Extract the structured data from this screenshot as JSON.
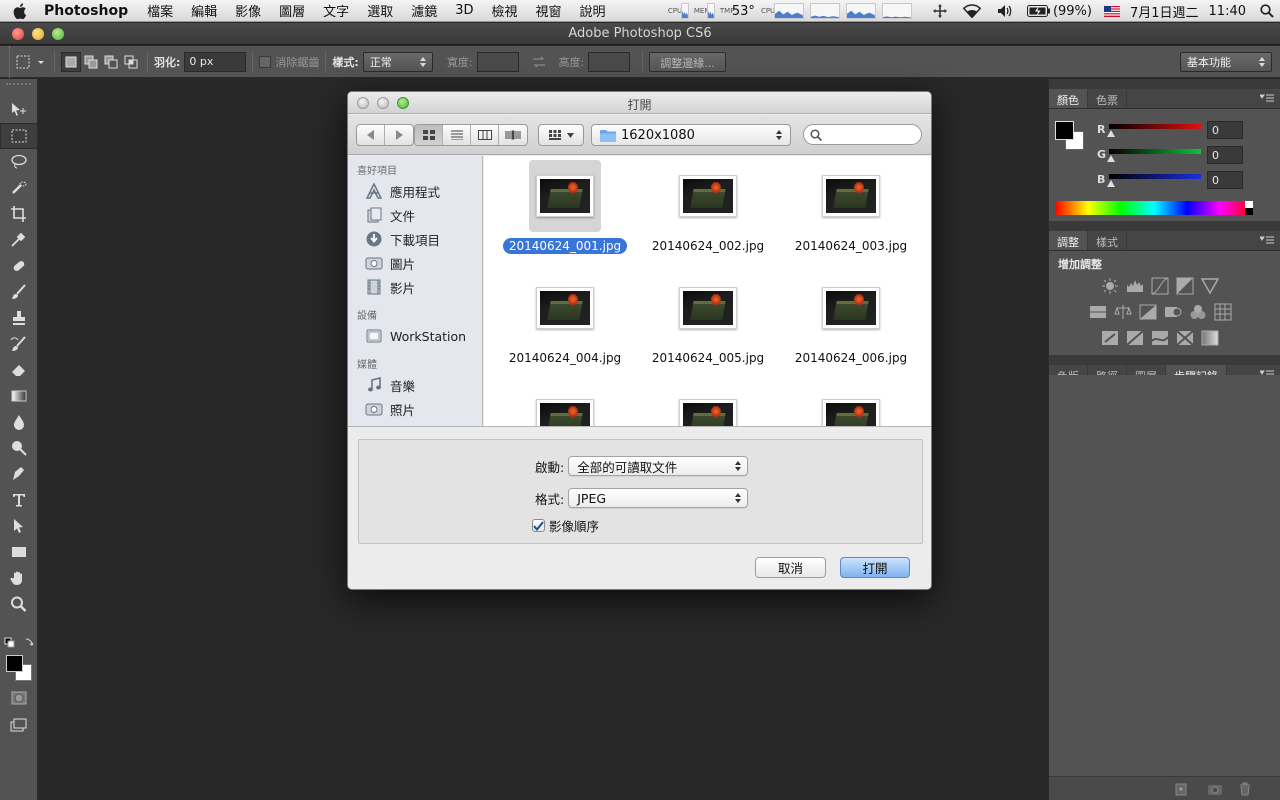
{
  "menubar": {
    "app_name": "Photoshop",
    "menus": [
      "檔案",
      "編輯",
      "影像",
      "圖層",
      "文字",
      "選取",
      "濾鏡",
      "3D",
      "檢視",
      "視窗",
      "說明"
    ],
    "stat_labels": [
      "CPU",
      "MEM",
      "TMP"
    ],
    "temperature": "53°",
    "battery": "(99%)",
    "date": "7月1日週二",
    "time": "11:40"
  },
  "ps_window": {
    "title": "Adobe Photoshop CS6"
  },
  "optionsbar": {
    "feather_label": "羽化:",
    "feather_value": "0 px",
    "antialias_label": "消除鋸齒",
    "style_label": "樣式:",
    "style_value": "正常",
    "width_label": "寬度:",
    "height_label": "高度:",
    "refine_button": "調整邊緣...",
    "workspace": "基本功能"
  },
  "panels": {
    "color_tabs": [
      "顏色",
      "色票"
    ],
    "rgb": [
      {
        "label": "R",
        "value": "0",
        "color": "#d6202a"
      },
      {
        "label": "G",
        "value": "0",
        "color": "#1fb246"
      },
      {
        "label": "B",
        "value": "0",
        "color": "#1f3ed6"
      }
    ],
    "adjust_tabs": [
      "調整",
      "樣式"
    ],
    "adjust_title": "增加調整",
    "layer_tabs": [
      "色版",
      "路徑",
      "圖層",
      "步驟記錄"
    ]
  },
  "dialog": {
    "title": "打開",
    "current_folder": "1620x1080",
    "search_placeholder": "",
    "sidebar": {
      "favorites_header": "喜好項目",
      "favorites": [
        {
          "label": "應用程式",
          "icon": "applications-icon"
        },
        {
          "label": "文件",
          "icon": "documents-icon"
        },
        {
          "label": "下載項目",
          "icon": "downloads-icon"
        },
        {
          "label": "圖片",
          "icon": "pictures-icon"
        },
        {
          "label": "影片",
          "icon": "movies-icon"
        }
      ],
      "devices_header": "設備",
      "devices": [
        {
          "label": "WorkStation",
          "icon": "hard-drive-icon"
        }
      ],
      "media_header": "媒體",
      "media": [
        {
          "label": "音樂",
          "icon": "music-icon"
        },
        {
          "label": "照片",
          "icon": "photos-icon"
        }
      ]
    },
    "files": [
      {
        "name": "20140624_001.jpg",
        "selected": true
      },
      {
        "name": "20140624_002.jpg",
        "selected": false
      },
      {
        "name": "20140624_003.jpg",
        "selected": false
      },
      {
        "name": "20140624_004.jpg",
        "selected": false
      },
      {
        "name": "20140624_005.jpg",
        "selected": false
      },
      {
        "name": "20140624_006.jpg",
        "selected": false
      },
      {
        "name": "",
        "selected": false
      },
      {
        "name": "",
        "selected": false
      },
      {
        "name": "",
        "selected": false
      }
    ],
    "enable_label": "啟動:",
    "enable_value": "全部的可讀取文件",
    "format_label": "格式:",
    "format_value": "JPEG",
    "image_sequence_label": "影像順序",
    "image_sequence_checked": true,
    "cancel_label": "取消",
    "open_label": "打開"
  }
}
